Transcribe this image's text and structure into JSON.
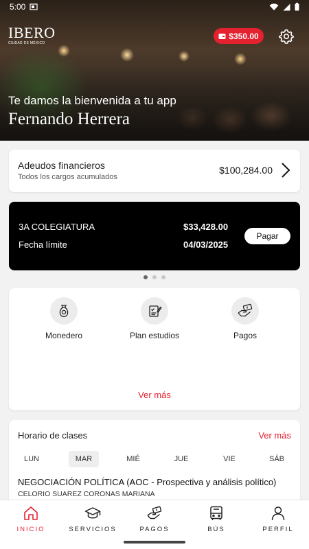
{
  "status_bar": {
    "time": "5:00"
  },
  "header": {
    "logo_main": "IBERO",
    "logo_sub": "CIUDAD DE MÉXICO",
    "wallet_balance": "$350.00",
    "greeting": "Te damos la bienvenida a tu app",
    "user_name": "Fernando Herrera"
  },
  "debt": {
    "title": "Adeudos financieros",
    "subtitle": "Todos los cargos acumulados",
    "amount": "$100,284.00"
  },
  "payment_card": {
    "concept": "3A COLEGIATURA",
    "amount": "$33,428.00",
    "due_label": "Fecha límite",
    "due_date": "04/03/2025",
    "pay_label": "Pagar"
  },
  "carousel": {
    "count": 3,
    "active": 0
  },
  "services": {
    "items": [
      {
        "label": "Monedero",
        "icon": "wallet-bag-icon"
      },
      {
        "label": "Plan estudios",
        "icon": "study-plan-icon"
      },
      {
        "label": "Pagos",
        "icon": "payment-hand-icon"
      }
    ],
    "see_more": "Ver más"
  },
  "schedule": {
    "title": "Horario de clases",
    "see_more": "Ver más",
    "days": [
      "LUN",
      "MAR",
      "MIÉ",
      "JUE",
      "VIE",
      "SÁB"
    ],
    "active_day": "MAR",
    "course": "NEGOCIACIÓN POLÍTICA (AOC - Prospectiva y análisis político)",
    "teacher": "CELORIO SUAREZ CORONAS MARIANA"
  },
  "nav": {
    "items": [
      {
        "label": "INICIO",
        "icon": "home-icon"
      },
      {
        "label": "SERVICIOS",
        "icon": "graduation-cap-icon"
      },
      {
        "label": "PAGOS",
        "icon": "payment-hand-icon"
      },
      {
        "label": "BÚS",
        "icon": "bus-icon"
      },
      {
        "label": "PERFIL",
        "icon": "person-icon"
      }
    ],
    "active": "INICIO"
  },
  "colors": {
    "accent": "#e4212f",
    "card_dark": "#000000",
    "background": "#f2f2f2"
  }
}
